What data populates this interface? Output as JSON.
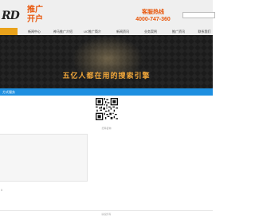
{
  "header": {
    "top_note": "",
    "logo_mark": "RD",
    "logo_lines": [
      "推广",
      "开户"
    ],
    "hotline_label": "客服热线",
    "hotline_number": "4000-747-360",
    "search_placeholder": "",
    "colors": {
      "accent": "#e8560a",
      "nav_active": "#e9a21b",
      "section_blue": "#1e8fe0"
    }
  },
  "nav": {
    "items": [
      {
        "label": "",
        "active": true
      },
      {
        "label": "新闻中心",
        "active": false
      },
      {
        "label": "神马推广介绍",
        "active": false
      },
      {
        "label": "UC推广简介",
        "active": false
      },
      {
        "label": "新闻资讯",
        "active": false
      },
      {
        "label": "业务案例",
        "active": false
      },
      {
        "label": "推广资讯",
        "active": false
      },
      {
        "label": "联系我们",
        "active": false
      }
    ]
  },
  "hero": {
    "slogan": "五亿人都在用的搜索引擎"
  },
  "section": {
    "title": "方式服务"
  },
  "qr": {
    "caption": "扫码咨询",
    "icon": "qr-code-icon"
  },
  "card": {
    "line_prefix": "",
    "line_red": "",
    "line_mid": "",
    "line_green": "",
    "line_suffix": ""
  },
  "side": {
    "mark": "0"
  },
  "footer": {
    "text": "版权所有"
  }
}
